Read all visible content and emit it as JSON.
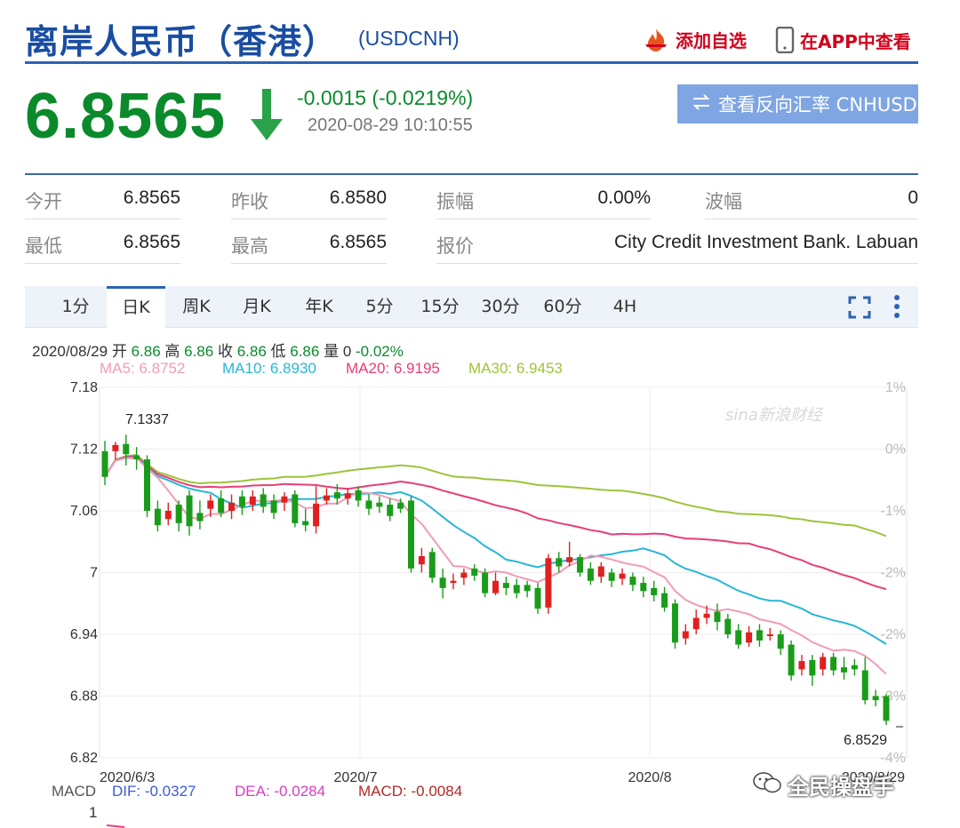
{
  "header": {
    "title": "离岸人民币（香港）",
    "code": "(USDCNH)",
    "add_watch": "添加自选",
    "view_app": "在APP中查看"
  },
  "quote": {
    "price": "6.8565",
    "change": "-0.0015 (-0.0219%)",
    "time": "2020-08-29 10:10:55",
    "reverse_button": "查看反向汇率 CNHUSD"
  },
  "stats": [
    {
      "label": "今开",
      "value": "6.8565"
    },
    {
      "label": "昨收",
      "value": "6.8580"
    },
    {
      "label": "振幅",
      "value": "0.00%"
    },
    {
      "label": "波幅",
      "value": "0"
    },
    {
      "label": "最低",
      "value": "6.8565"
    },
    {
      "label": "最高",
      "value": "6.8565"
    },
    {
      "label": "报价",
      "value": "City Credit Investment Bank. Labuan"
    }
  ],
  "tabs": [
    "1分",
    "日K",
    "周K",
    "月K",
    "年K",
    "5分",
    "15分",
    "30分",
    "60分",
    "4H"
  ],
  "active_tab": "日K",
  "ohlc_bar": {
    "date": "2020/08/29",
    "open_label": "开",
    "open": "6.86",
    "high_label": "高",
    "high": "6.86",
    "close_label": "收",
    "close": "6.86",
    "low_label": "低",
    "low": "6.86",
    "vol_label": "量",
    "vol": "0",
    "pct": "-0.02%"
  },
  "ma": {
    "ma5": "MA5: 6.8752",
    "ma10": "MA10: 6.8930",
    "ma20": "MA20: 6.9195",
    "ma30": "MA30: 6.9453"
  },
  "colors": {
    "up": "#e02020",
    "down": "#1a9c1a",
    "ma5": "#f29bb6",
    "ma10": "#28b6d8",
    "ma20": "#e83e76",
    "ma30": "#9ec33a",
    "brand": "#1a4da2"
  },
  "macd": {
    "label": "MACD",
    "dif": "DIF: -0.0327",
    "dea": "DEA: -0.0284",
    "macd": "MACD: -0.0084",
    "axis_top": "1"
  },
  "watermark_logo": "sina新浪财经",
  "watermark_wechat": "全民操盘手",
  "chart_data": {
    "type": "candlestick",
    "ylim": [
      6.82,
      7.18
    ],
    "y_ticks": [
      "7.18",
      "7.12",
      "7.06",
      "7",
      "6.94",
      "6.88",
      "6.82"
    ],
    "pct_ticks": [
      "1%",
      "0%",
      "-1%",
      "-2%",
      "-2%",
      "-3%",
      "-4%"
    ],
    "x_labels": [
      "2020/6/3",
      "2020/7",
      "2020/8",
      "2020/8/29"
    ],
    "max_label": "7.1337",
    "min_label": "6.8529",
    "candles": [
      [
        7.118,
        7.093,
        7.128,
        7.085
      ],
      [
        7.118,
        7.124,
        7.127,
        7.11
      ],
      [
        7.125,
        7.115,
        7.134,
        7.104
      ],
      [
        7.114,
        7.11,
        7.122,
        7.1
      ],
      [
        7.11,
        7.06,
        7.114,
        7.054
      ],
      [
        7.062,
        7.046,
        7.07,
        7.04
      ],
      [
        7.052,
        7.06,
        7.068,
        7.046
      ],
      [
        7.066,
        7.048,
        7.07,
        7.04
      ],
      [
        7.075,
        7.045,
        7.08,
        7.036
      ],
      [
        7.058,
        7.05,
        7.07,
        7.042
      ],
      [
        7.062,
        7.07,
        7.076,
        7.054
      ],
      [
        7.072,
        7.058,
        7.08,
        7.054
      ],
      [
        7.06,
        7.068,
        7.076,
        7.052
      ],
      [
        7.074,
        7.064,
        7.08,
        7.056
      ],
      [
        7.066,
        7.074,
        7.08,
        7.06
      ],
      [
        7.076,
        7.064,
        7.082,
        7.058
      ],
      [
        7.07,
        7.058,
        7.076,
        7.052
      ],
      [
        7.068,
        7.074,
        7.078,
        7.06
      ],
      [
        7.076,
        7.048,
        7.08,
        7.044
      ],
      [
        7.05,
        7.046,
        7.062,
        7.04
      ],
      [
        7.045,
        7.067,
        7.084,
        7.038
      ],
      [
        7.07,
        7.075,
        7.082,
        7.066
      ],
      [
        7.078,
        7.072,
        7.086,
        7.066
      ],
      [
        7.072,
        7.077,
        7.082,
        7.066
      ],
      [
        7.08,
        7.07,
        7.084,
        7.064
      ],
      [
        7.07,
        7.062,
        7.076,
        7.056
      ],
      [
        7.068,
        7.064,
        7.074,
        7.058
      ],
      [
        7.066,
        7.055,
        7.072,
        7.05
      ],
      [
        7.068,
        7.062,
        7.072,
        7.058
      ],
      [
        7.07,
        7.004,
        7.074,
        7.0
      ],
      [
        7.008,
        7.016,
        7.024,
        7.0
      ],
      [
        7.02,
        6.995,
        7.024,
        6.99
      ],
      [
        6.995,
        6.985,
        7.004,
        6.975
      ],
      [
        6.99,
        6.992,
        6.999,
        6.984
      ],
      [
        6.995,
        7.0,
        7.004,
        6.988
      ],
      [
        7.004,
        6.997,
        7.008,
        6.992
      ],
      [
        7.0,
        6.98,
        7.004,
        6.976
      ],
      [
        6.98,
        6.992,
        7.0,
        6.978
      ],
      [
        6.99,
        6.985,
        6.996,
        6.978
      ],
      [
        6.988,
        6.98,
        6.994,
        6.975
      ],
      [
        6.988,
        6.982,
        6.992,
        6.976
      ],
      [
        6.985,
        6.965,
        6.99,
        6.96
      ],
      [
        6.966,
        7.014,
        7.018,
        6.96
      ],
      [
        7.014,
        7.006,
        7.02,
        7.0
      ],
      [
        7.01,
        7.015,
        7.03,
        7.006
      ],
      [
        7.015,
        7.0,
        7.018,
        6.996
      ],
      [
        7.004,
        6.992,
        7.01,
        6.988
      ],
      [
        6.996,
        7.006,
        7.01,
        6.99
      ],
      [
        7.0,
        6.992,
        7.004,
        6.986
      ],
      [
        6.994,
        6.999,
        7.004,
        6.988
      ],
      [
        6.996,
        6.988,
        7.0,
        6.982
      ],
      [
        6.99,
        6.982,
        6.996,
        6.976
      ],
      [
        6.985,
        6.978,
        6.992,
        6.972
      ],
      [
        6.98,
        6.966,
        6.986,
        6.962
      ],
      [
        6.97,
        6.932,
        6.974,
        6.926
      ],
      [
        6.936,
        6.943,
        6.95,
        6.93
      ],
      [
        6.945,
        6.956,
        6.964,
        6.94
      ],
      [
        6.956,
        6.96,
        6.968,
        6.95
      ],
      [
        6.962,
        6.952,
        6.97,
        6.944
      ],
      [
        6.955,
        6.94,
        6.96,
        6.936
      ],
      [
        6.944,
        6.93,
        6.95,
        6.926
      ],
      [
        6.932,
        6.942,
        6.948,
        6.928
      ],
      [
        6.944,
        6.934,
        6.95,
        6.928
      ],
      [
        6.94,
        6.94,
        6.946,
        6.934
      ],
      [
        6.94,
        6.926,
        6.944,
        6.92
      ],
      [
        6.93,
        6.9,
        6.934,
        6.895
      ],
      [
        6.906,
        6.914,
        6.92,
        6.9
      ],
      [
        6.915,
        6.9,
        6.92,
        6.89
      ],
      [
        6.906,
        6.918,
        6.922,
        6.9
      ],
      [
        6.918,
        6.905,
        6.922,
        6.9
      ],
      [
        6.908,
        6.903,
        6.918,
        6.896
      ],
      [
        6.91,
        6.906,
        6.916,
        6.9
      ],
      [
        6.905,
        6.876,
        6.918,
        6.872
      ],
      [
        6.88,
        6.876,
        6.886,
        6.87
      ],
      [
        6.88,
        6.856,
        6.882,
        6.852
      ]
    ]
  }
}
